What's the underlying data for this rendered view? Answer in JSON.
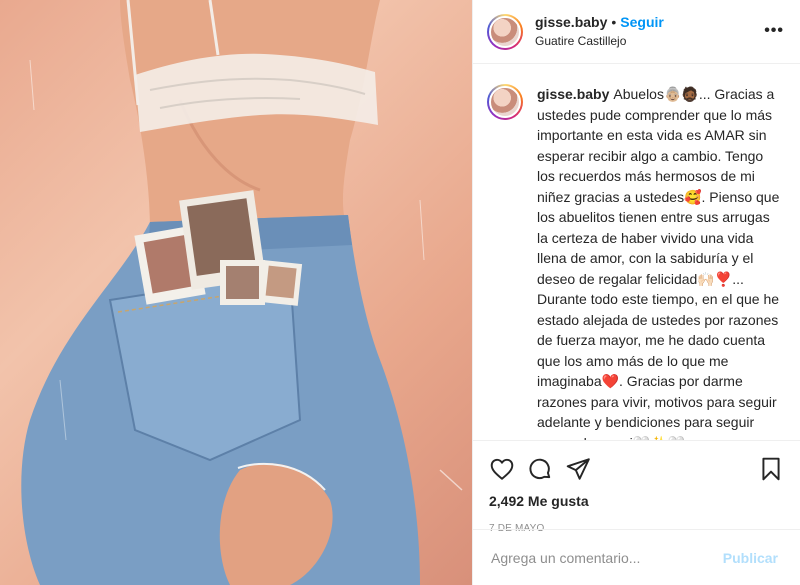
{
  "post": {
    "username": "gisse.baby",
    "separator": "•",
    "follow_label": "Seguir",
    "location": "Guatire Castillejo",
    "more_label": "•••",
    "caption": [
      "Abuelos👵🏼🧔🏾... Gracias a ustedes pude comprender que lo más importante en esta vida es AMAR sin esperar recibir algo a cambio. Tengo los recuerdos más hermosos de mi niñez gracias a ustedes🥰. Pienso que los abuelitos tienen entre sus arrugas la certeza de haber vivido una vida llena de amor, con la sabiduría y el deseo de regalar felicidad🙌🏻❣️... Durante todo este tiempo, en el que he estado alejada de ustedes por razones de fuerza mayor, me he dado cuenta que los amo más de lo que me imaginaba❤️. Gracias por darme razones para vivir, motivos para seguir adelante y bendiciones para seguir creyendo en mi🤍✨🤍.",
      "•",
      "•"
    ],
    "likes": "2,492 Me gusta",
    "date": "7 DE MAYO",
    "comment_placeholder": "Agrega un comentario...",
    "publish_label": "Publicar"
  },
  "icons": {
    "like": "heart-icon",
    "comment": "comment-bubble-icon",
    "share": "paper-plane-icon",
    "save": "bookmark-icon",
    "more": "more-options-icon"
  },
  "colors": {
    "link_blue": "#0095f6",
    "publish_disabled": "#b2dffc",
    "muted": "#8e8e8e"
  }
}
